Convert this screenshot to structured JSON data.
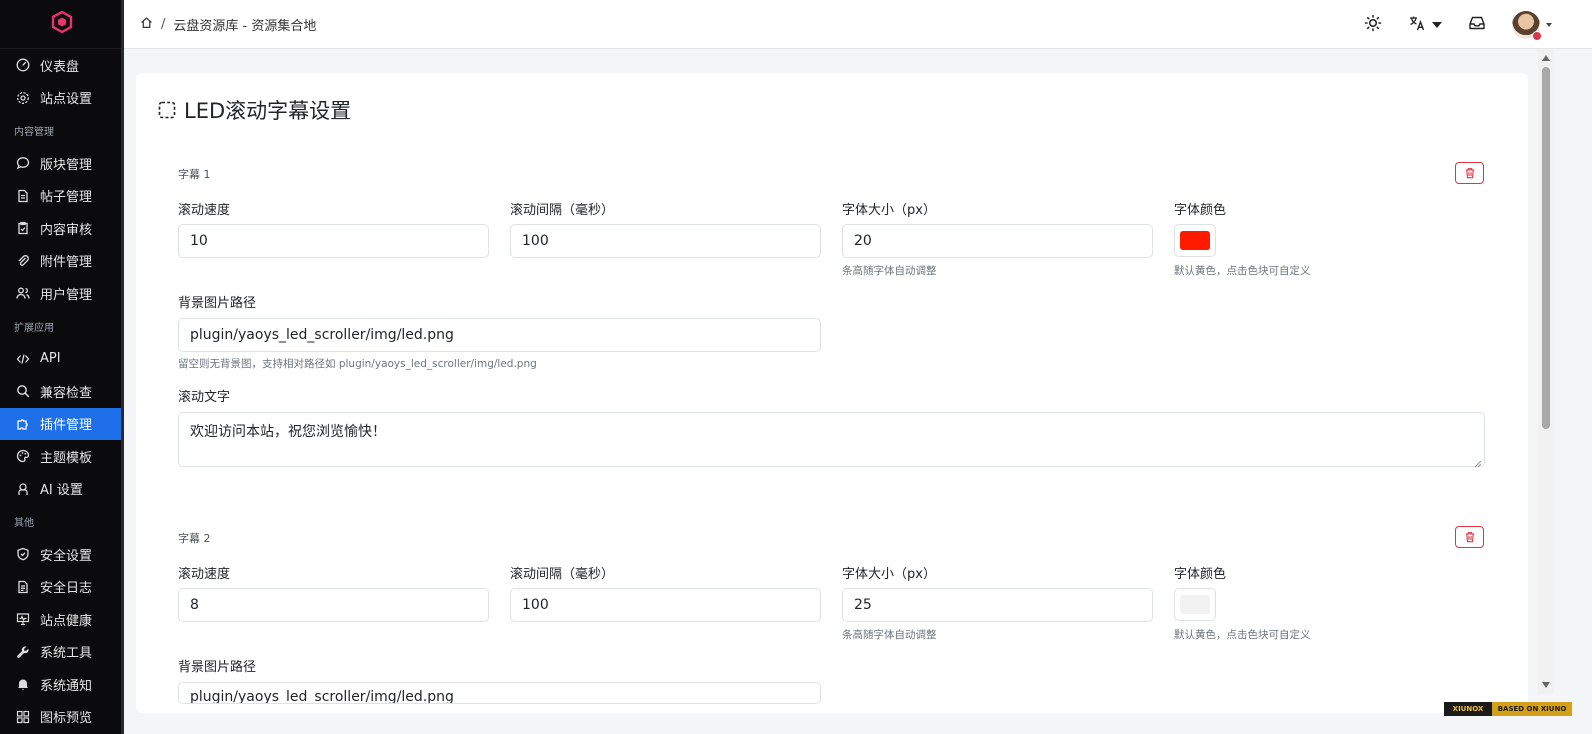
{
  "sidebar": {
    "items": [
      {
        "id": "dashboard",
        "label": "仪表盘",
        "icon": "gauge-icon"
      },
      {
        "id": "site-settings",
        "label": "站点设置",
        "icon": "gear-icon"
      },
      {
        "section": "内容管理"
      },
      {
        "id": "board",
        "label": "版块管理",
        "icon": "chat-bubble-icon"
      },
      {
        "id": "posts",
        "label": "帖子管理",
        "icon": "document-icon"
      },
      {
        "id": "review",
        "label": "内容审核",
        "icon": "clipboard-check-icon"
      },
      {
        "id": "attachments",
        "label": "附件管理",
        "icon": "paperclip-icon"
      },
      {
        "id": "users",
        "label": "用户管理",
        "icon": "users-icon"
      },
      {
        "section": "扩展应用"
      },
      {
        "id": "api",
        "label": "API",
        "icon": "code-icon"
      },
      {
        "id": "compat",
        "label": "兼容检查",
        "icon": "search-icon"
      },
      {
        "id": "plugins",
        "label": "插件管理",
        "icon": "puzzle-icon",
        "active": true
      },
      {
        "id": "themes",
        "label": "主题模板",
        "icon": "palette-icon"
      },
      {
        "id": "ai",
        "label": "AI 设置",
        "icon": "robot-icon"
      },
      {
        "section": "其他"
      },
      {
        "id": "security",
        "label": "安全设置",
        "icon": "shield-icon"
      },
      {
        "id": "security-log",
        "label": "安全日志",
        "icon": "log-icon"
      },
      {
        "id": "health",
        "label": "站点健康",
        "icon": "monitor-icon"
      },
      {
        "id": "tools",
        "label": "系统工具",
        "icon": "wrench-icon"
      },
      {
        "id": "notify",
        "label": "系统通知",
        "icon": "bell-icon"
      },
      {
        "id": "icons",
        "label": "图标预览",
        "icon": "grid-icon"
      }
    ]
  },
  "header": {
    "breadcrumb_site": "云盘资源库 - 资源集合地"
  },
  "page": {
    "title": "LED滚动字幕设置"
  },
  "labels": {
    "speed": "滚动速度",
    "interval": "滚动间隔（毫秒）",
    "font_size": "字体大小（px）",
    "font_color": "字体颜色",
    "font_size_hint": "条高随字体自动调整",
    "color_hint": "默认黄色，点击色块可自定义",
    "bg_path": "背景图片路径",
    "bg_hint": "留空则无背景图，支持相对路径如 plugin/yaoys_led_scroller/img/led.png",
    "text": "滚动文字"
  },
  "subtitles": [
    {
      "label": "字幕 1",
      "speed": "10",
      "interval": "100",
      "font_size": "20",
      "color": "#ff1a00",
      "bg_path": "plugin/yaoys_led_scroller/img/led.png",
      "text": "欢迎访问本站，祝您浏览愉快！"
    },
    {
      "label": "字幕 2",
      "speed": "8",
      "interval": "100",
      "font_size": "25",
      "color": "#f2f2f2",
      "bg_path": "plugin/yaoys_led_scroller/img/led.png"
    }
  ],
  "footer": {
    "left": "XIUNOX",
    "right": "BASED ON XIUNO"
  },
  "colors": {
    "accent": "#1f6feb",
    "sidebar_bg": "#0b0b0d",
    "danger": "#dc3545",
    "logo": "#e8336d"
  }
}
